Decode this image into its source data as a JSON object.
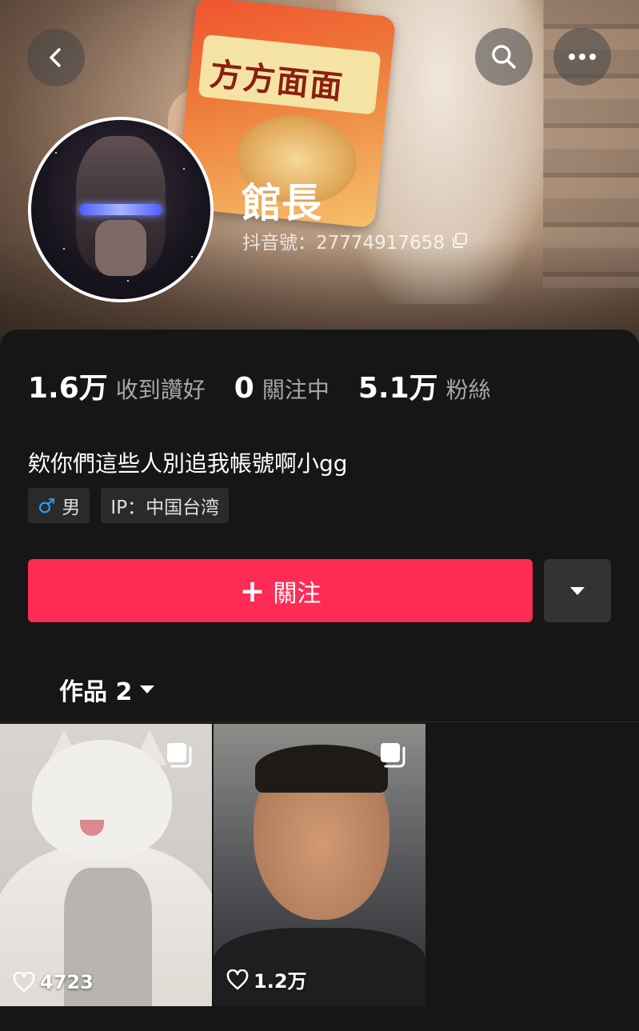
{
  "profile": {
    "name": "館長",
    "douyin_id": "抖音號：27774917658",
    "bio": "欸你們這些人別追我帳號啊小gg",
    "gender": "男",
    "ip": "IP：中国台湾"
  },
  "stats": [
    {
      "value": "1.6万",
      "label": "收到讚好"
    },
    {
      "value": "0",
      "label": "關注中"
    },
    {
      "value": "5.1万",
      "label": "粉絲"
    }
  ],
  "header": {
    "snack_text": "方方面面"
  },
  "actions": {
    "follow_label": "關注",
    "follow_plus": "+"
  },
  "works": {
    "tab_label": "作品 2",
    "items": [
      {
        "likes": "4723"
      },
      {
        "likes": "1.2万"
      }
    ]
  },
  "colors": {
    "accent": "#fe2c55",
    "background": "#161616",
    "tag_bg": "#2a2a2a",
    "male_icon": "#2f9bff"
  },
  "icons": [
    "back-arrow-icon",
    "search-icon",
    "more-icon",
    "copy-icon",
    "male-icon",
    "plus-icon",
    "caret-down-icon",
    "multi-image-icon",
    "heart-icon"
  ]
}
